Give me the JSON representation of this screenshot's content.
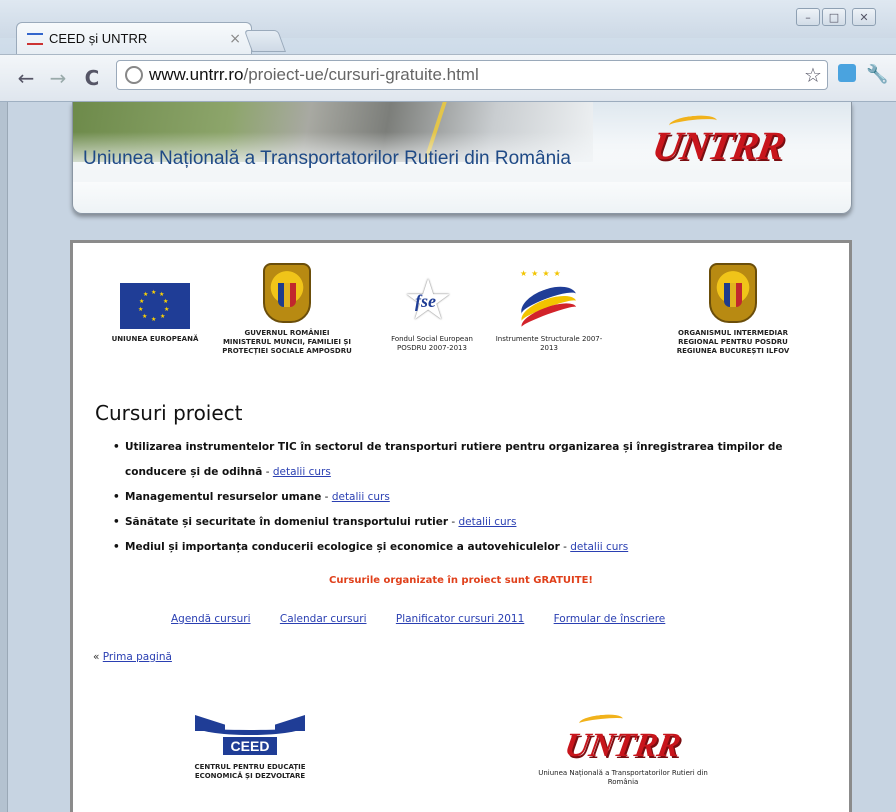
{
  "browser": {
    "tab_title": "CEED și UNTRR",
    "tab_close": "×",
    "url_host": "www.untrr.ro",
    "url_path": "/proiect-ue/cursuri-gratuite.html",
    "nav": {
      "back": "←",
      "forward": "→",
      "reload": "C"
    },
    "tools": {
      "star": "☆",
      "wrench": "🔧"
    },
    "window": {
      "minimize": "–",
      "maximize": "□",
      "close": "✕"
    }
  },
  "header": {
    "site_title": "Uniunea Națională a Transportatorilor Rutieri din România",
    "logo_text": "UNTRR"
  },
  "partner_logos": [
    {
      "id": "eu",
      "caption": "UNIUNEA EUROPEANĂ"
    },
    {
      "id": "gov",
      "caption": "GUVERNUL ROMÂNIEI MINISTERUL MUNCII, FAMILIEI ȘI PROTECȚIEI SOCIALE AMPOSDRU"
    },
    {
      "id": "fse",
      "caption": "Fondul Social European POSDRU 2007-2013"
    },
    {
      "id": "instr",
      "caption": "Instrumente Structurale 2007-2013"
    },
    {
      "id": "oir",
      "caption": "ORGANISMUL INTERMEDIAR REGIONAL PENTRU POSDRU REGIUNEA BUCUREȘTI ILFOV"
    }
  ],
  "fse_logo_text": "fse",
  "main": {
    "heading": "Cursuri proiect",
    "courses": [
      {
        "title": "Utilizarea instrumentelor TIC în sectorul de transporturi rutiere pentru organizarea și înregistrarea timpilor de conducere și de odihnă",
        "link": "detalii curs"
      },
      {
        "title": "Managementul resurselor umane",
        "link": "detalii curs"
      },
      {
        "title": "Sănătate și securitate în domeniul transportului rutier",
        "link": "detalii curs"
      },
      {
        "title": "Mediul și importanța conducerii ecologice și economice a autovehiculelor",
        "link": "detalii curs"
      }
    ],
    "separator": " - ",
    "free_notice": "Cursurile organizate în proiect sunt GRATUITE!",
    "links": [
      "Agendă cursuri",
      "Calendar cursuri",
      "Planificator cursuri 2011",
      "Formular de înscriere"
    ],
    "home_prefix": "« ",
    "home_link": "Prima pagină"
  },
  "footer": {
    "ceed_word": "CEED",
    "ceed_caption": "CENTRUL PENTRU EDUCAȚIE ECONOMICĂ ȘI DEZVOLTARE",
    "untrr_word": "UNTRR",
    "untrr_caption": "Uniunea Națională a Transportatorilor Rutieri din România"
  }
}
